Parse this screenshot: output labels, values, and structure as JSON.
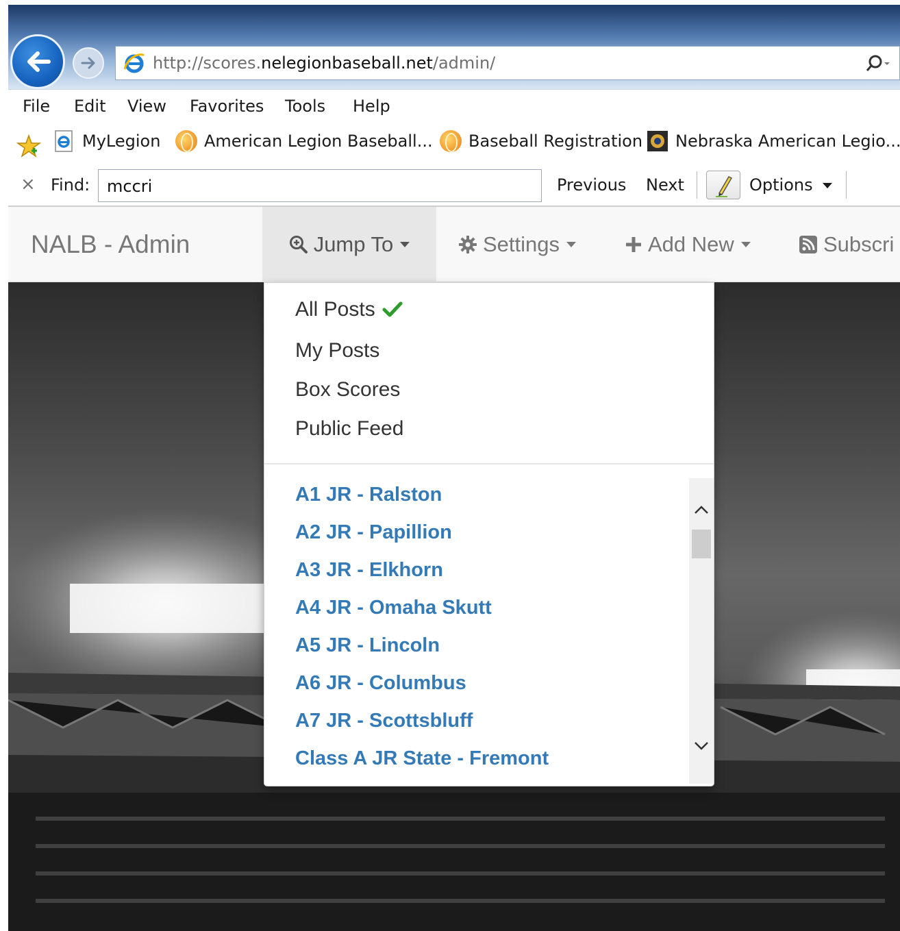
{
  "browser": {
    "url_prefix": "http://scores.",
    "url_domain": "nelegionbaseball.net",
    "url_path": "/admin/",
    "menu": [
      "File",
      "Edit",
      "View",
      "Favorites",
      "Tools",
      "Help"
    ],
    "favorites": [
      "MyLegion",
      "American Legion Baseball...",
      "Baseball Registration",
      "Nebraska American Legio..."
    ],
    "find": {
      "close": "×",
      "label": "Find:",
      "value": "mccri",
      "previous": "Previous",
      "next": "Next",
      "options": "Options"
    }
  },
  "navbar": {
    "brand": "NALB - Admin",
    "items": [
      {
        "label": "Jump To",
        "icon": "zoom-in-icon"
      },
      {
        "label": "Settings",
        "icon": "gear-icon"
      },
      {
        "label": "Add New",
        "icon": "plus-icon"
      },
      {
        "label": "Subscri",
        "icon": "rss-icon"
      }
    ]
  },
  "dropdown": {
    "views": [
      {
        "label": "All Posts",
        "checked": true
      },
      {
        "label": "My Posts",
        "checked": false
      },
      {
        "label": "Box Scores",
        "checked": false
      },
      {
        "label": "Public Feed",
        "checked": false
      }
    ],
    "feeds": [
      "A1 JR - Ralston",
      "A2 JR - Papillion",
      "A3 JR - Elkhorn",
      "A4 JR - Omaha Skutt",
      "A5 JR - Lincoln",
      "A6 JR - Columbus",
      "A7 JR - Scottsbluff",
      "Class A JR State - Fremont"
    ],
    "scroll_position": 0.1
  },
  "colors": {
    "link": "#337ab7",
    "check": "#2e9d2e",
    "nav_text": "#777777",
    "nav_bg": "#f8f8f8"
  }
}
